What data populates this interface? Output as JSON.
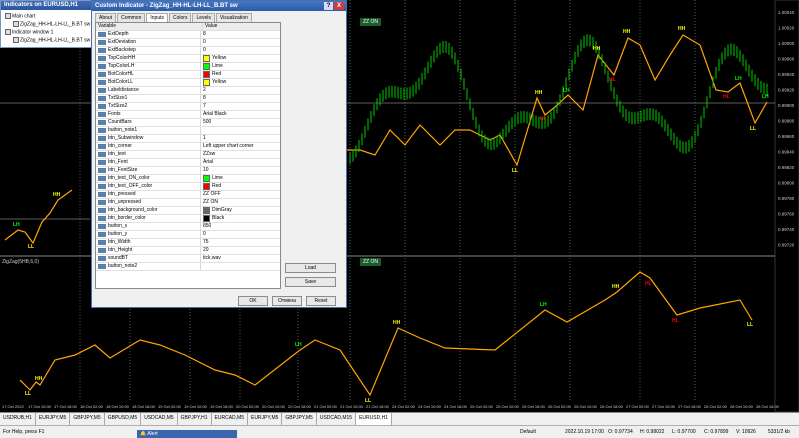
{
  "navigator": {
    "title": "Indicators on EURUSD,H1",
    "items": [
      "Main chart",
      "ZigZag_HH-HL-LH-LL_B.BT sw",
      "Indicator window 1",
      "ZigZag_HH-HL-LH-LL_B.BT sw"
    ]
  },
  "dialog": {
    "title": "Custom Indicator - ZigZag_HH-HL-LH-LL_B.BT sw",
    "help": "?",
    "close": "X",
    "tabs": [
      "About",
      "Common",
      "Inputs",
      "Colors",
      "Levels",
      "Visualization"
    ],
    "active_tab": "Inputs",
    "columns": [
      "Variable",
      "Value"
    ],
    "params": [
      {
        "name": "ExtDepth",
        "value": "8"
      },
      {
        "name": "ExtDeviation",
        "value": "0"
      },
      {
        "name": "ExtBackstep",
        "value": "0"
      },
      {
        "name": "TopColorHH",
        "value": "Yellow",
        "color": "#ffff00"
      },
      {
        "name": "TopColorLH",
        "value": "Lime",
        "color": "#00ff00"
      },
      {
        "name": "BotColorHL",
        "value": "Red",
        "color": "#ff0000"
      },
      {
        "name": "BotColorLL",
        "value": "Yellow",
        "color": "#ffff00"
      },
      {
        "name": "Labeldistance",
        "value": "2"
      },
      {
        "name": "TxtSize1",
        "value": "8"
      },
      {
        "name": "TxtSize2",
        "value": "7"
      },
      {
        "name": "Fonts",
        "value": "Arial Black"
      },
      {
        "name": "CountBars",
        "value": "500"
      },
      {
        "name": "button_note1",
        "value": ""
      },
      {
        "name": "btn_Subwindow",
        "value": "1"
      },
      {
        "name": "btn_corner",
        "value": "Left upper chart corner"
      },
      {
        "name": "btn_text",
        "value": "ZZsw"
      },
      {
        "name": "btn_Font",
        "value": "Arial"
      },
      {
        "name": "btn_FontSize",
        "value": "10"
      },
      {
        "name": "btn_text_ON_color",
        "value": "Lime",
        "color": "#00ff00"
      },
      {
        "name": "btn_text_OFF_color",
        "value": "Red",
        "color": "#ff0000"
      },
      {
        "name": "btn_pressed",
        "value": "ZZ OFF"
      },
      {
        "name": "btn_unpressed",
        "value": "ZZ ON"
      },
      {
        "name": "btn_background_color",
        "value": "DimGray",
        "color": "#696969"
      },
      {
        "name": "btn_border_color",
        "value": "Black",
        "color": "#000000"
      },
      {
        "name": "button_x",
        "value": "850"
      },
      {
        "name": "button_y",
        "value": "0"
      },
      {
        "name": "btn_Width",
        "value": "75"
      },
      {
        "name": "btn_Height",
        "value": "20"
      },
      {
        "name": "soundBT",
        "value": "tick.wav"
      },
      {
        "name": "button_note2",
        "value": ""
      }
    ],
    "load": "Load",
    "save": "Save",
    "ok": "OK",
    "cancel": "Отмена",
    "reset": "Reset"
  },
  "chart": {
    "main_button": "ZZ ON",
    "sub_button": "ZZ ON",
    "sub_label": "ZigZag(5HB,6,0)",
    "colors": {
      "line": "#ffa500",
      "hh": "#ffff00",
      "lh": "#00ff00",
      "hl": "#ff0000",
      "ll": "#ffff00",
      "price": "#00c800"
    },
    "price_labels": [
      "1.00040",
      "1.00020",
      "1.00000",
      "0.99960",
      "0.99940",
      "0.99920",
      "0.99900",
      "0.99880",
      "0.99860",
      "0.99840",
      "0.99820",
      "0.99800",
      "0.99780",
      "0.99760",
      "0.99740",
      "0.99720"
    ],
    "time_labels": [
      "17 Oct 2022",
      "17 Oct 10:00",
      "17 Oct 18:00",
      "18 Oct 02:00",
      "18 Oct 10:00",
      "18 Oct 18:00",
      "19 Oct 02:00",
      "19 Oct 10:00",
      "19 Oct 18:00",
      "20 Oct 02:00",
      "20 Oct 10:00",
      "20 Oct 18:00",
      "21 Oct 02:00",
      "21 Oct 10:00",
      "21 Oct 18:00",
      "24 Oct 02:00",
      "24 Oct 10:00",
      "24 Oct 18:00",
      "25 Oct 02:00",
      "25 Oct 10:00",
      "25 Oct 18:00",
      "26 Oct 02:00",
      "26 Oct 10:00",
      "26 Oct 18:00",
      "27 Oct 02:00",
      "27 Oct 10:00",
      "27 Oct 18:00",
      "28 Oct 02:00",
      "28 Oct 10:00",
      "28 Oct 18:00"
    ]
  },
  "symbol_tabs": [
    "USDRUB,H1",
    "EURJPY,M5",
    "GBPJPY,M5",
    "GBPUSD,M5",
    "USDCAD,M5",
    "GBPJPY,H1",
    "EURCAD,M5",
    "EURJPY,M5",
    "GBPJPY,M5",
    "USDCAD,M15",
    "EURUSD,H1"
  ],
  "active_symbol_tab": "EURUSD,H1",
  "status": {
    "help": "For Help, press F1",
    "alert": "Alert",
    "profile": "Default",
    "time": "2022.10.19 17:00",
    "open": "O: 0.97734",
    "high": "H: 0.98022",
    "low": "L: 0.97700",
    "close": "C: 0.97899",
    "volume": "V: 10926",
    "traffic": "5331/2 kb"
  }
}
